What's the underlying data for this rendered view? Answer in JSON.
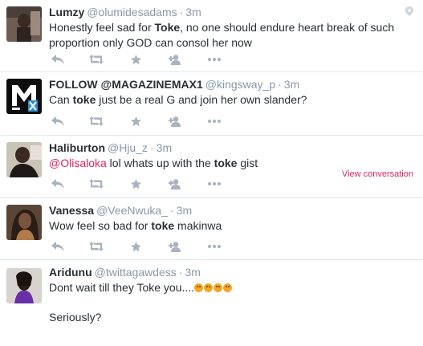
{
  "tweets": [
    {
      "fullname": "Lumzy",
      "username": "@olumidesadams",
      "time": "3m",
      "text_before": "Honestly feel sad for ",
      "text_bold": "Toke",
      "text_after": ", no one should endure heart break of such proportion only GOD can consol her now"
    },
    {
      "fullname": "FOLLOW @MAGAZINEMAX1",
      "username": "@kingsway_p",
      "time": "3m",
      "text_before": "Can ",
      "text_bold": "toke",
      "text_after": " just be a real G and join her own slander?",
      "avatar_letters": "MAX"
    },
    {
      "fullname": "Haliburton",
      "username": "@Hju_z",
      "time": "3m",
      "mention": "@Olisaloka",
      "text_before": " lol whats up with the ",
      "text_bold": "toke",
      "text_after": " gist",
      "view_conversation": "View conversation"
    },
    {
      "fullname": "Vanessa",
      "username": "@VeeNwuka_",
      "time": "3m",
      "text_before": "Wow feel so bad for ",
      "text_bold": "toke",
      "text_after": " makinwa"
    },
    {
      "fullname": "Aridunu",
      "username": "@twittagawdess",
      "time": "3m",
      "text_line1": "Dont wait till they Toke you....",
      "text_line2": "Seriously?",
      "emoji_count": 4
    }
  ],
  "separator": "·",
  "icons": {
    "reply": "reply-icon",
    "retweet": "retweet-icon",
    "favorite": "favorite-icon",
    "follow": "follow-icon",
    "more": "more-icon",
    "pin": "location-pin-icon"
  },
  "colors": {
    "icon": "#a8b3bd",
    "mention": "#e0245e",
    "border": "#e1e8ed",
    "meta": "#8899a6"
  }
}
